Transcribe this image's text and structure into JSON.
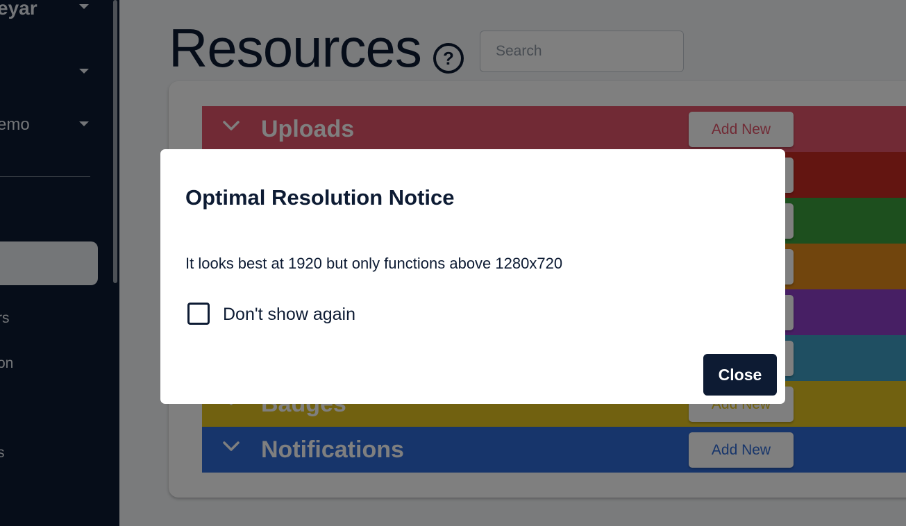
{
  "sidebar": {
    "items": [
      {
        "label": "eyar"
      },
      {
        "label": ""
      },
      {
        "label": "emo"
      }
    ],
    "links": [
      {
        "label": "rs"
      },
      {
        "label": "on"
      },
      {
        "label": "s"
      }
    ]
  },
  "page": {
    "title": "Resources",
    "help_icon": "?",
    "search_placeholder": "Search"
  },
  "resources": [
    {
      "name": "Uploads",
      "add_label": "Add New",
      "color": "#e2556a",
      "text_color": "#e2556a"
    },
    {
      "name": "",
      "add_label": "Add New",
      "color": "#c62b22",
      "text_color": "#c62b22"
    },
    {
      "name": "",
      "add_label": "Add New",
      "color": "#3a9e3c",
      "text_color": "#3a9e3c"
    },
    {
      "name": "",
      "add_label": "Add New",
      "color": "#e38a1a",
      "text_color": "#e38a1a"
    },
    {
      "name": "",
      "add_label": "Add New",
      "color": "#8f3fc9",
      "text_color": "#8f3fc9"
    },
    {
      "name": "",
      "add_label": "Add New",
      "color": "#3f9fc4",
      "text_color": "#3f9fc4"
    },
    {
      "name": "Badges",
      "add_label": "Add New",
      "color": "#e2c321",
      "text_color": "#e2c321"
    },
    {
      "name": "Notifications",
      "add_label": "Add New",
      "color": "#2f6bd6",
      "text_color": "#2f6bd6"
    }
  ],
  "modal": {
    "title": "Optimal Resolution Notice",
    "body": "It looks best at 1920 but only functions above 1280x720",
    "checkbox_label": "Don't show again",
    "close_label": "Close"
  }
}
